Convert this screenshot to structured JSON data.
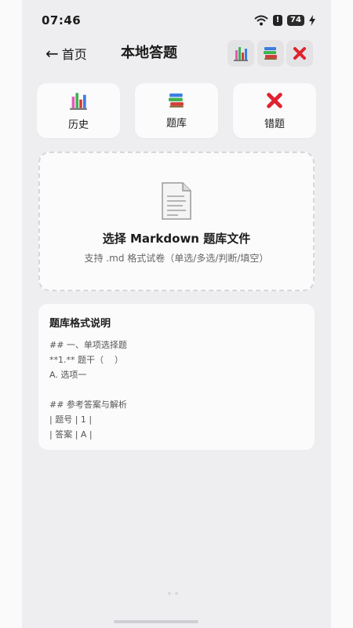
{
  "status_bar": {
    "time": "07:46",
    "battery": "74"
  },
  "header": {
    "back_label": "首页",
    "title": "本地答题",
    "icons": [
      "bar-chart-icon",
      "books-icon",
      "cross-mark-icon"
    ]
  },
  "tiles": [
    {
      "label": "历史",
      "icon": "bar-chart-icon"
    },
    {
      "label": "题库",
      "icon": "books-icon"
    },
    {
      "label": "错题",
      "icon": "cross-mark-icon"
    }
  ],
  "upload": {
    "title": "选择 Markdown 题库文件",
    "subtitle": "支持 .md 格式试卷（单选/多选/判断/填空）",
    "icon": "document-icon"
  },
  "format_guide": {
    "title": "题库格式说明",
    "lines": [
      "## 一、单项选择题",
      "**1.** 题干（    ）",
      "A. 选项一",
      "",
      "## 参考答案与解析",
      "| 题号 | 1 |",
      "| 答案 | A |"
    ]
  },
  "colors": {
    "cross_red": "#e0222e",
    "background": "#eeeef0",
    "card": "#fbfbfc"
  }
}
